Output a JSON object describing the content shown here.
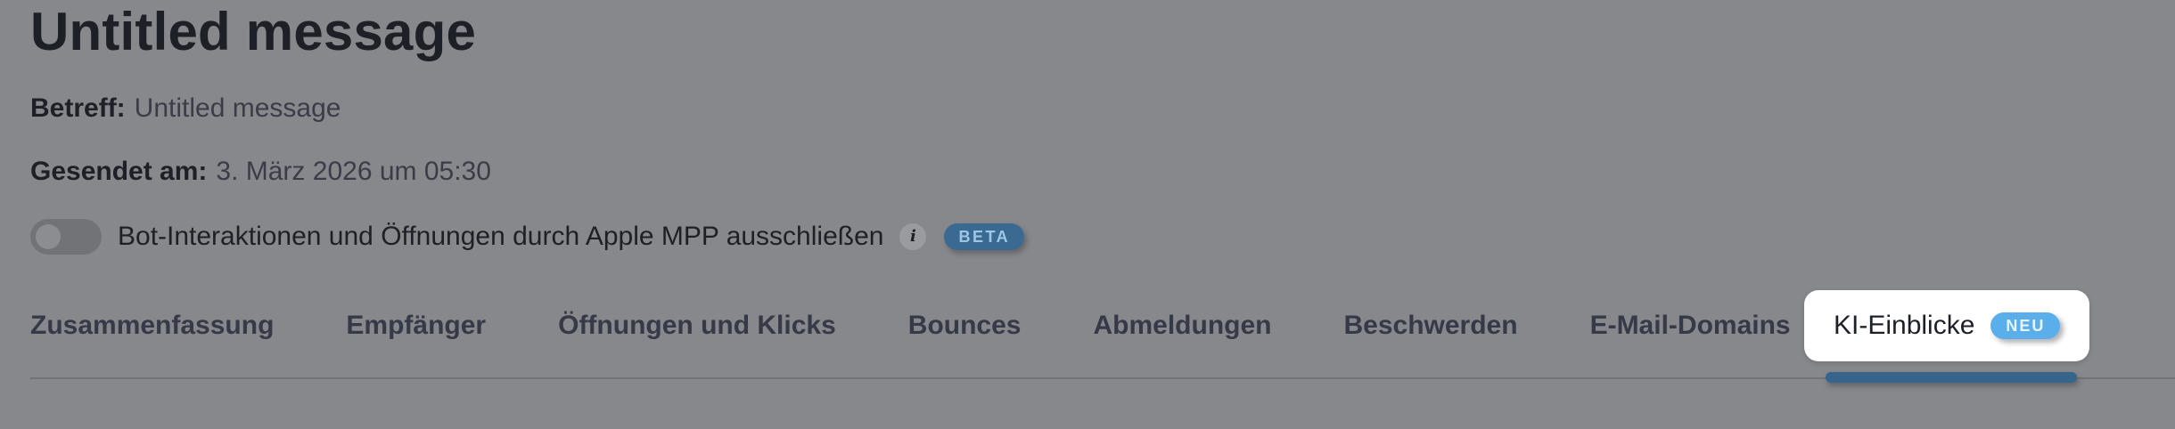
{
  "message": {
    "title": "Untitled message",
    "subject_label": "Betreff:",
    "subject_value": "Untitled message",
    "sent_label": "Gesendet am:",
    "sent_value": "3. März 2026 um 05:30"
  },
  "filter": {
    "toggle_on": false,
    "label": "Bot-Interaktionen und Öffnungen durch Apple MPP ausschließen",
    "info_icon": "info-icon",
    "badge": "BETA"
  },
  "tabs": [
    {
      "label": "Zusammenfassung"
    },
    {
      "label": "Empfänger"
    },
    {
      "label": "Öffnungen und Klicks"
    },
    {
      "label": "Bounces"
    },
    {
      "label": "Abmeldungen"
    },
    {
      "label": "Beschwerden"
    },
    {
      "label": "E-Mail-Domains"
    },
    {
      "label": "KI-Einblicke",
      "badge": "NEU",
      "active": true
    }
  ],
  "colors": {
    "overlay_background": "#87888b",
    "active_tab_underline": "#36648b",
    "beta_badge": "#3a6a92",
    "neu_badge": "#5aaeea"
  }
}
